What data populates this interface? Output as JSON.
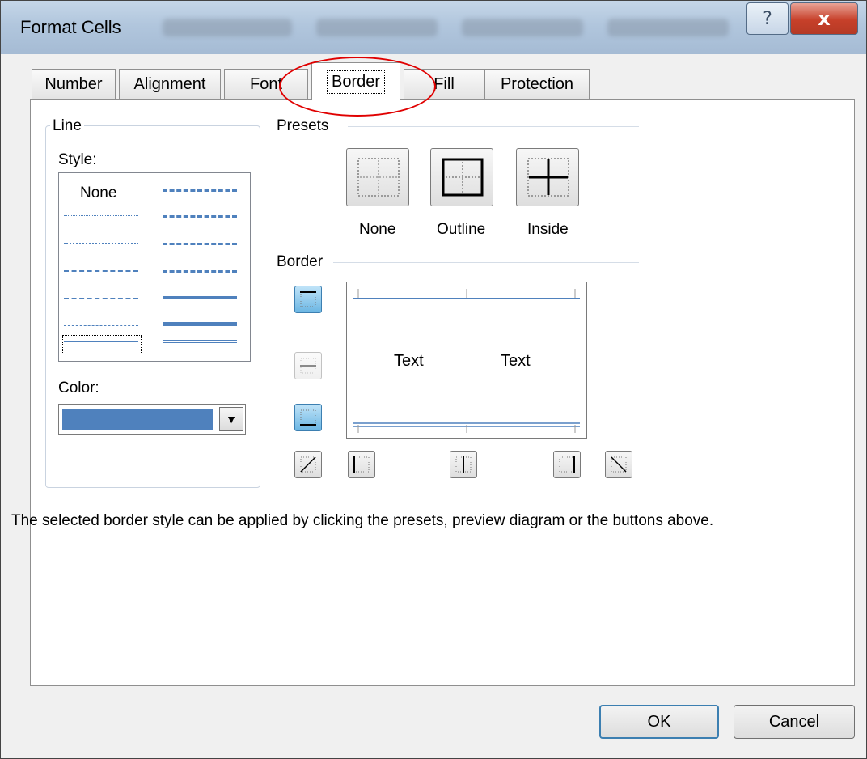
{
  "window": {
    "title": "Format Cells",
    "help_label": "?",
    "close_label": "x"
  },
  "tabs": [
    {
      "label": "Number"
    },
    {
      "label": "Alignment"
    },
    {
      "label": "Font"
    },
    {
      "label": "Border",
      "active": true
    },
    {
      "label": "Fill"
    },
    {
      "label": "Protection"
    }
  ],
  "line": {
    "group_label": "Line",
    "style_label": "Style:",
    "style_none": "None",
    "color_label": "Color:",
    "color_value": "#4f81bd",
    "dropdown_icon": "▼"
  },
  "presets": {
    "label": "Presets",
    "items": [
      {
        "label": "None",
        "icon": "preset-none-icon"
      },
      {
        "label": "Outline",
        "icon": "preset-outline-icon"
      },
      {
        "label": "Inside",
        "icon": "preset-inside-icon"
      }
    ]
  },
  "border": {
    "label": "Border",
    "preview_text_left": "Text",
    "preview_text_right": "Text"
  },
  "hint": "The selected border style can be applied by clicking the presets, preview diagram or the buttons above.",
  "buttons": {
    "ok": "OK",
    "cancel": "Cancel"
  },
  "colors": {
    "accent": "#4f81bd",
    "highlight_circle": "#e00000"
  }
}
